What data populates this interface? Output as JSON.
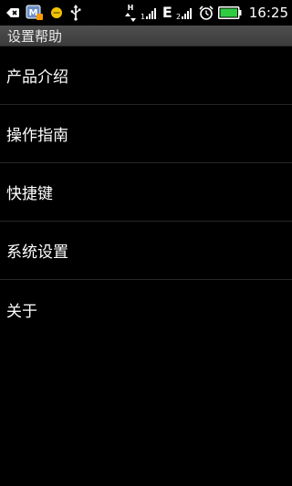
{
  "status_bar": {
    "time": "16:25",
    "network_type": "E",
    "hspa_label": "H",
    "battery_color": "#2ecc40",
    "icons": [
      "back-arrow-icon",
      "mail-notification-icon",
      "emoticon-icon",
      "usb-icon",
      "data-transfer-icon",
      "signal-icon",
      "signal-icon-2",
      "alarm-icon",
      "battery-icon"
    ]
  },
  "title_bar": {
    "title": "设置帮助"
  },
  "menu": {
    "items": [
      {
        "label": "产品介绍"
      },
      {
        "label": "操作指南"
      },
      {
        "label": "快捷键"
      },
      {
        "label": "系统设置"
      },
      {
        "label": "关于"
      }
    ]
  }
}
